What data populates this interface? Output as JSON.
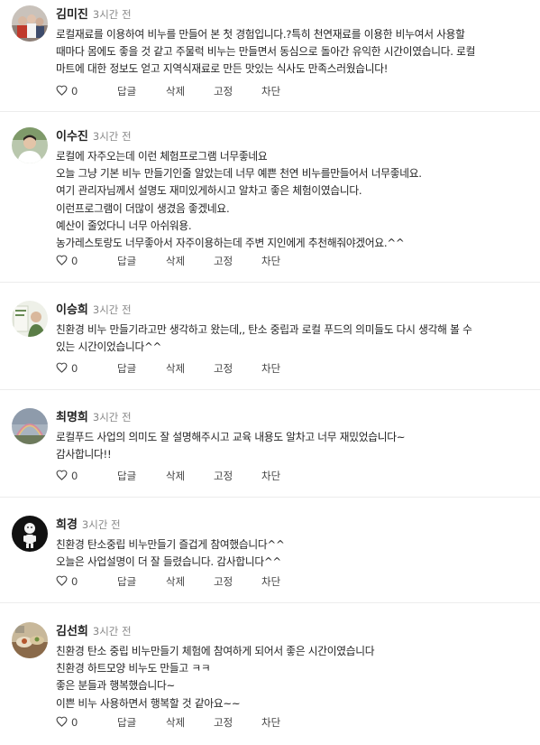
{
  "actions": {
    "reply": "답글",
    "delete": "삭제",
    "pin": "고정",
    "block": "차단"
  },
  "comments": [
    {
      "author": "김미진",
      "time": "3시간 전",
      "text": "로컬재료를 이용하여 비누를 만들어 본 첫 경험입니다.?특히 천연재료를 이용한 비누여서 사용할\n때마다 몸에도 좋을 것 같고 주물럭 비누는 만들면서 동심으로 돌아간 유익한 시간이였습니다. 로컬\n마트에 대한 정보도 얻고 지역식재료로 만든 맛있는 식사도 만족스러웠습니다!",
      "likes": "0",
      "avatar_icon": "group-photo-avatar-icon"
    },
    {
      "author": "이수진",
      "time": "3시간 전",
      "text": "로컬에 자주오는데 이런 체험프로그램 너무좋네요\n오늘 그냥 기본 비누 만들기인줄 알았는데 너무 예쁜 천연 비누를만들어서 너무좋네요.\n여기 관리자님께서 설명도 재미있게하시고 알차고 좋은 체험이였습니다.\n이런프로그램이 더많이 생겼음 좋겠네요.\n예산이 줄었다니 너무 아쉬워용.\n농가레스토랑도 너무좋아서 자주이용하는데 주변 지인에게 추천해줘야겠어요.^^",
      "likes": "0",
      "avatar_icon": "person-photo-avatar-icon"
    },
    {
      "author": "이승희",
      "time": "3시간 전",
      "text": "친환경 비누 만들기라고만 생각하고 왔는데,, 탄소 중립과 로컬 푸드의 의미들도 다시 생각해 볼 수\n있는 시간이었습니다^^",
      "likes": "0",
      "avatar_icon": "card-photo-avatar-icon"
    },
    {
      "author": "최명희",
      "time": "3시간 전",
      "text": "로컬푸드 사업의 의미도 잘 설명해주시고 교육 내용도 알차고 너무 재밌었습니다~\n감사합니다!!",
      "likes": "0",
      "avatar_icon": "sky-photo-avatar-icon"
    },
    {
      "author": "희경",
      "time": "3시간 전",
      "text": "친환경 탄소중립 비누만들기 즐겁게 참여했습니다^^\n오늘은 사업설명이 더  잘 들렸습니다.  감사합니다^^",
      "likes": "0",
      "avatar_icon": "character-avatar-icon"
    },
    {
      "author": "김선희",
      "time": "3시간 전",
      "text": "친환경 탄소 중립 비누만들기 체험에 참여하게 되어서 좋은 시간이였습니다\n친환경 하트모양 비누도 만들고 ㅋㅋ\n좋은 분들과 행복했습니다~\n이쁜 비누 사용하면서 행복할 것 같아요~~",
      "likes": "0",
      "avatar_icon": "food-photo-avatar-icon"
    }
  ]
}
